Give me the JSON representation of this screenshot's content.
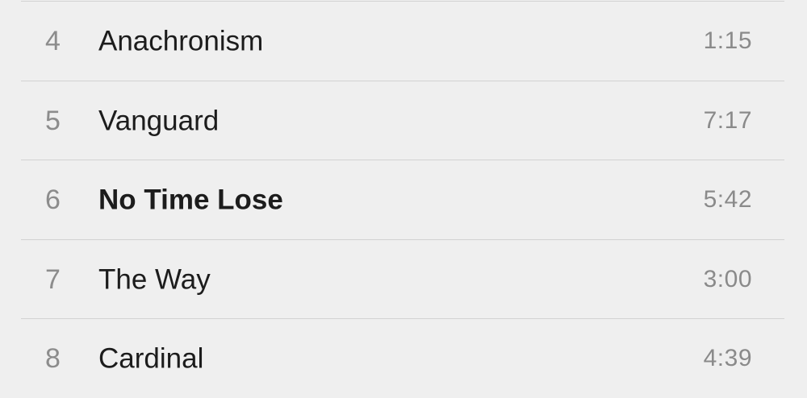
{
  "tracks": [
    {
      "number": "4",
      "title": "Anachronism",
      "duration": "1:15",
      "current": false
    },
    {
      "number": "5",
      "title": "Vanguard",
      "duration": "7:17",
      "current": false
    },
    {
      "number": "6",
      "title": "No Time Lose",
      "duration": "5:42",
      "current": true
    },
    {
      "number": "7",
      "title": "The Way",
      "duration": "3:00",
      "current": false
    },
    {
      "number": "8",
      "title": "Cardinal",
      "duration": "4:39",
      "current": false
    }
  ]
}
